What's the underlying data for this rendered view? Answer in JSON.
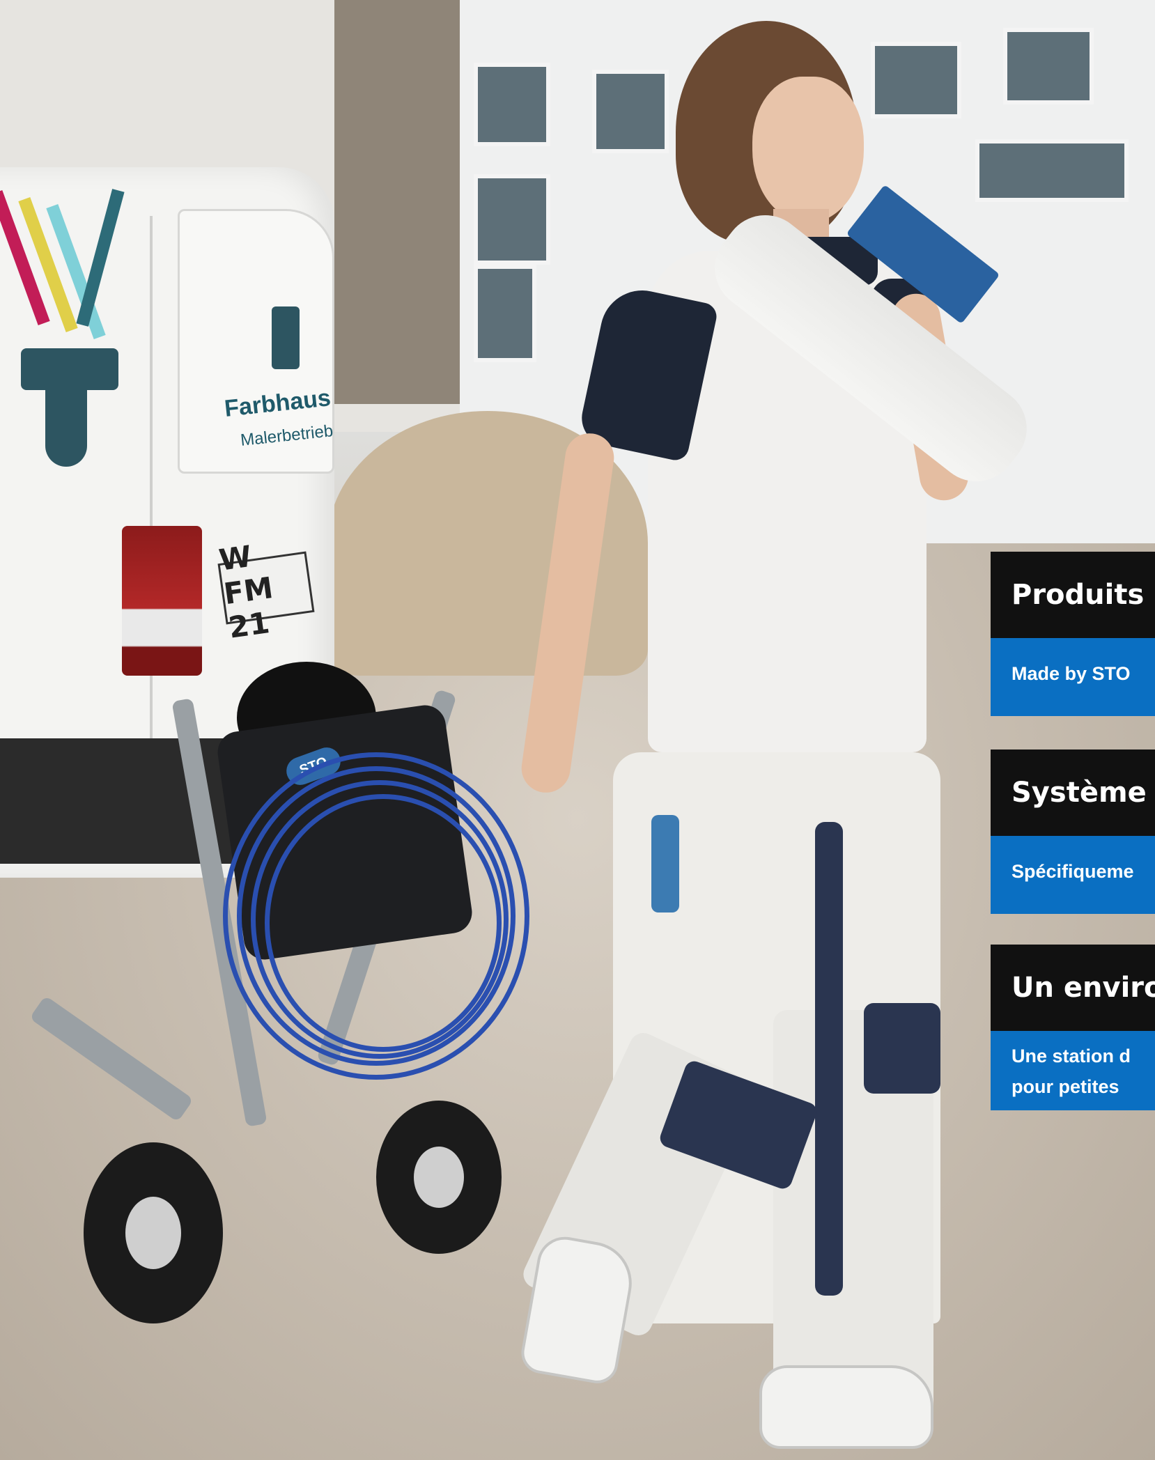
{
  "menu": [
    {
      "title": "Produits",
      "subtitle_lines": [
        "Made by STO"
      ]
    },
    {
      "title": "Système",
      "subtitle_lines": [
        "Spécifiqueme"
      ]
    },
    {
      "title": "Un enviro",
      "subtitle_lines": [
        "Une station d",
        "pour petites"
      ]
    }
  ],
  "scene": {
    "van_brand": "Farbhaus",
    "van_subtitle": "Malerbetrieb",
    "license_plate": "W FM 21",
    "machine_logo": "STO"
  },
  "colors": {
    "panel_dark": "#111111",
    "panel_blue": "#0a6fc2",
    "hose_blue": "#2a4fb0"
  }
}
